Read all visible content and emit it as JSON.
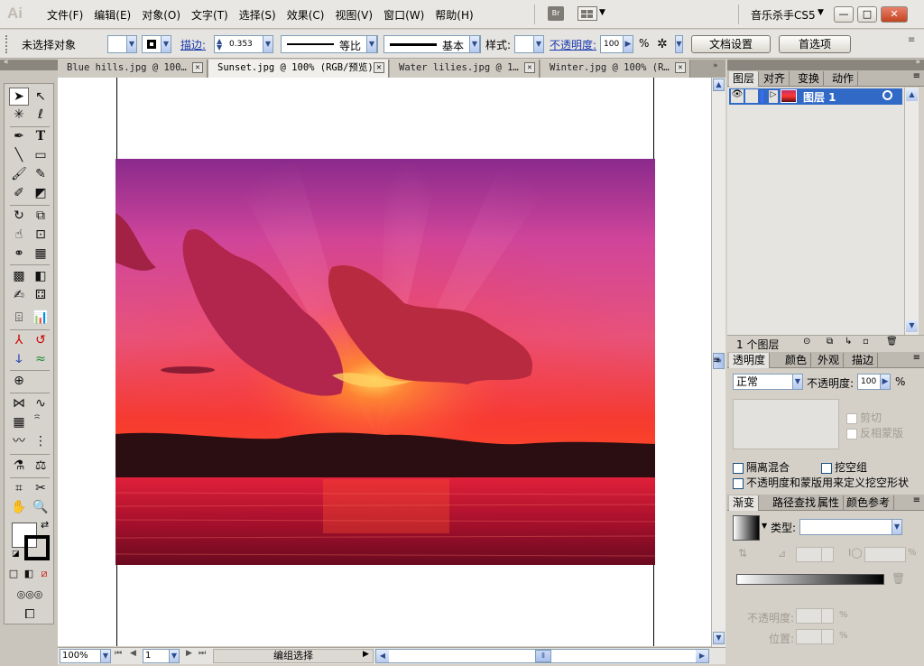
{
  "app": {
    "logo": "Ai",
    "bridge": "Br"
  },
  "menu": [
    "文件(F)",
    "编辑(E)",
    "对象(O)",
    "文字(T)",
    "选择(S)",
    "效果(C)",
    "视图(V)",
    "窗口(W)",
    "帮助(H)"
  ],
  "workspace": "音乐杀手CS5",
  "window_buttons": {
    "minimize": "—",
    "maximize": "□",
    "close": "✕"
  },
  "control": {
    "selection": "未选择对象",
    "stroke_label": "描边:",
    "stroke_value": "0.353",
    "profile": "等比",
    "brush": "基本",
    "style_label": "样式:",
    "opacity_label": "不透明度:",
    "opacity_value": "100",
    "percent": "%",
    "doc_setup": "文档设置",
    "prefs": "首选项"
  },
  "tabs": [
    {
      "label": "Blue hills.jpg @ 100…",
      "active": false
    },
    {
      "label": "Sunset.jpg @ 100%  (RGB/预览)",
      "active": true
    },
    {
      "label": "Water lilies.jpg @ 1…",
      "active": false
    },
    {
      "label": "Winter.jpg @ 100%  (R…",
      "active": false
    }
  ],
  "status": {
    "zoom": "100%",
    "page": "1",
    "mode": "编组选择"
  },
  "layers": {
    "tabs": [
      "图层",
      "对齐",
      "变换",
      "动作"
    ],
    "layer_name": "图层 1",
    "count": "1 个图层"
  },
  "transparency": {
    "tabs": [
      "透明度",
      "颜色",
      "外观",
      "描边"
    ],
    "blend_mode": "正常",
    "opacity_label": "不透明度:",
    "opacity_value": "100",
    "percent": "%",
    "clip": "剪切",
    "invert_mask": "反相蒙版",
    "isolate": "隔离混合",
    "knockout": "挖空组",
    "define_knockout": "不透明度和蒙版用来定义挖空形状"
  },
  "gradient": {
    "tabs": [
      "渐变",
      "路径查找",
      "属性",
      "颜色参考"
    ],
    "type_label": "类型:",
    "opacity_label": "不透明度:",
    "location_label": "位置:",
    "percent": "%"
  },
  "colors": {
    "accent": "#316ac5",
    "tab_active": "#f1efeb"
  }
}
